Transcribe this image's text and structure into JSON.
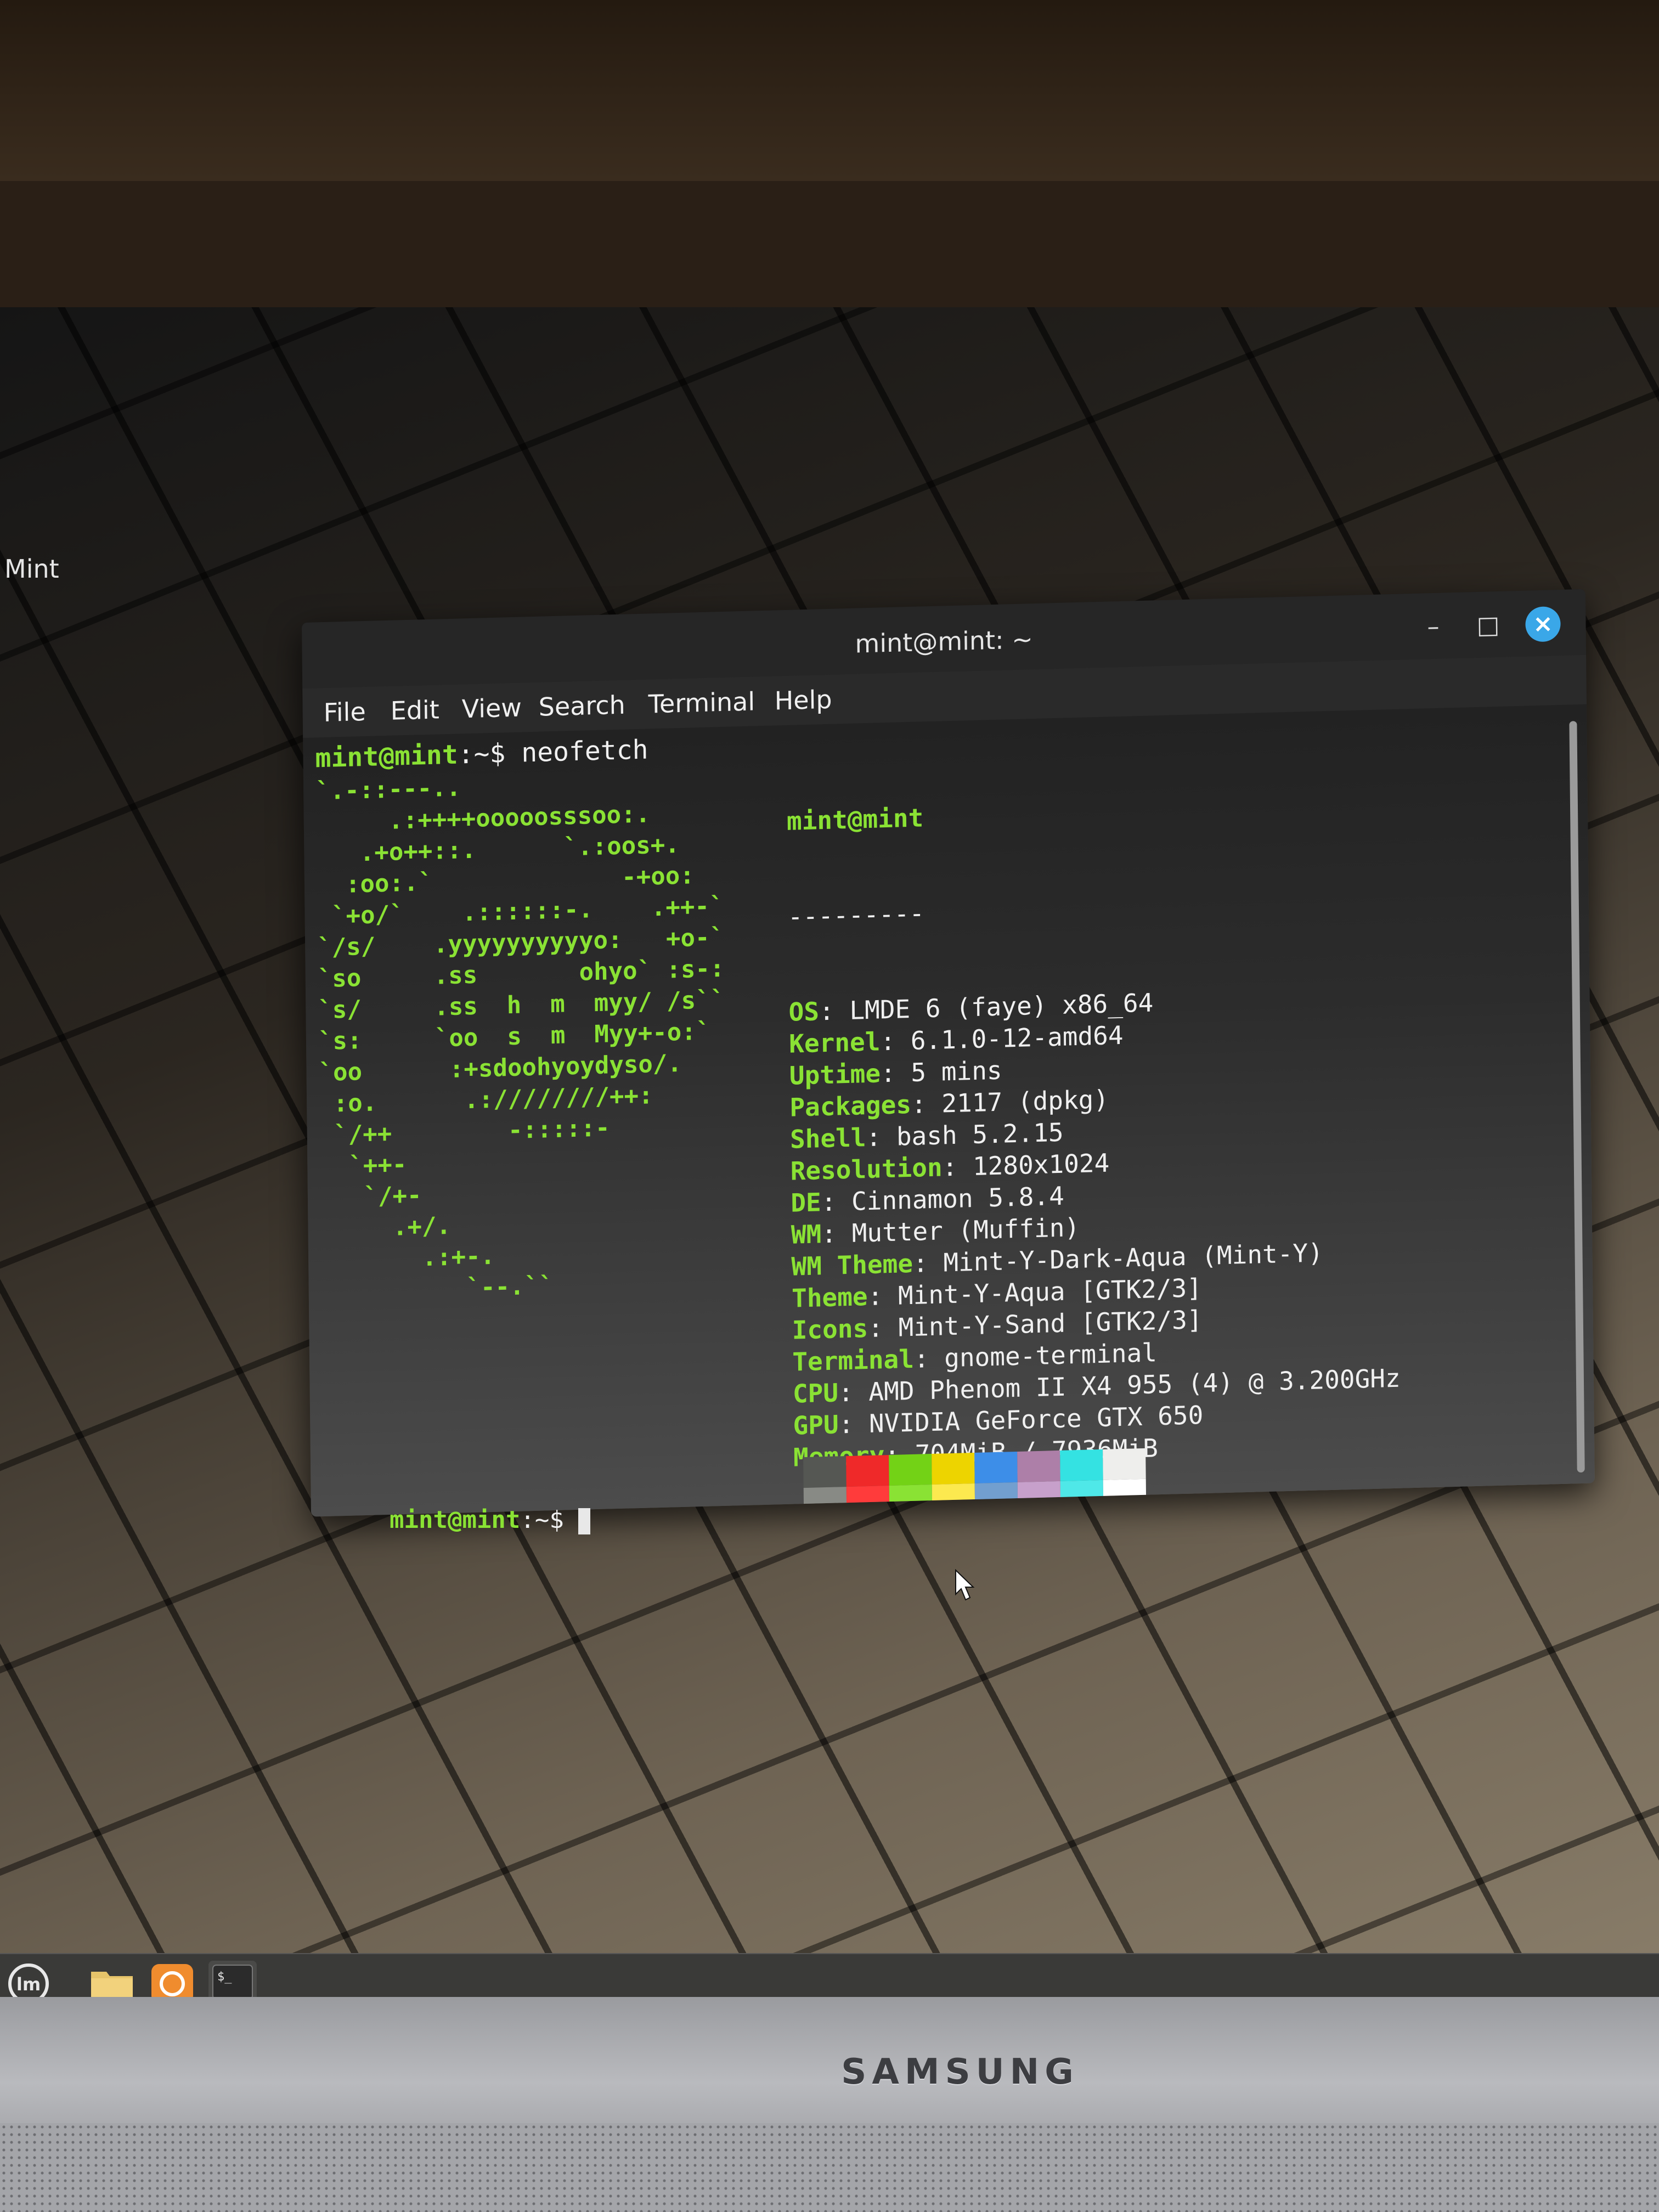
{
  "desktop": {
    "label": "Mint",
    "monitor_brand": "SAMSUNG"
  },
  "terminal": {
    "title": "mint@mint: ~",
    "menu": [
      "File",
      "Edit",
      "View",
      "Search",
      "Terminal",
      "Help"
    ],
    "prompt_user": "mint@mint",
    "prompt_path": ":~$",
    "command": "neofetch",
    "ascii_art": [
      "`.-::---..",
      "     .:++++ooooosssoo:.",
      "   .+o++::.      `.:oos+.",
      "  :oo:.`             -+oo:",
      " `+o/`    .::::::-.    .++-`",
      "`/s/    .yyyyyyyyyyo:   +o-`",
      "`so     .ss       ohyo` :s-:",
      "`s/     .ss  h  m  myy/ /s``",
      "`s:     `oo  s  m  Myy+-o:`",
      "`oo      :+sdoohyoydyso/.",
      " :o.      .:////////++:",
      " `/++        -:::::-",
      "  `++-",
      "   `/+-",
      "     .+/.",
      "       .:+-.",
      "          `--.``"
    ],
    "header": "mint@mint",
    "separator": "---------",
    "info": [
      {
        "key": "OS",
        "value": "LMDE 6 (faye) x86_64"
      },
      {
        "key": "Kernel",
        "value": "6.1.0-12-amd64"
      },
      {
        "key": "Uptime",
        "value": "5 mins"
      },
      {
        "key": "Packages",
        "value": "2117 (dpkg)"
      },
      {
        "key": "Shell",
        "value": "bash 5.2.15"
      },
      {
        "key": "Resolution",
        "value": "1280x1024"
      },
      {
        "key": "DE",
        "value": "Cinnamon 5.8.4"
      },
      {
        "key": "WM",
        "value": "Mutter (Muffin)"
      },
      {
        "key": "WM Theme",
        "value": "Mint-Y-Dark-Aqua (Mint-Y)"
      },
      {
        "key": "Theme",
        "value": "Mint-Y-Aqua [GTK2/3]"
      },
      {
        "key": "Icons",
        "value": "Mint-Y-Sand [GTK2/3]"
      },
      {
        "key": "Terminal",
        "value": "gnome-terminal"
      },
      {
        "key": "CPU",
        "value": "AMD Phenom II X4 955 (4) @ 3.200GHz"
      },
      {
        "key": "GPU",
        "value": "NVIDIA GeForce GTX 650"
      },
      {
        "key": "Memory",
        "value": "704MiB / 7936MiB"
      }
    ],
    "palette_top": [
      "#555753",
      "#ef2929",
      "#73d216",
      "#edd400",
      "#3d8ee8",
      "#ad7fa8",
      "#34e2e2",
      "#eeeeec"
    ],
    "palette_bottom": [
      "#888a85",
      "#ff3b3b",
      "#8ae234",
      "#fce94f",
      "#729fcf",
      "#c7a0cb",
      "#4fe8e8",
      "#ffffff"
    ]
  },
  "icons": {
    "close": "close-icon",
    "minimize": "minimize-icon",
    "maximize": "maximize-icon",
    "menu": "mint-menu-icon",
    "files": "folder-icon",
    "update": "update-manager-icon",
    "terminal": "terminal-icon"
  },
  "colors": {
    "accent": "#3aa7e8",
    "prompt_green": "#8ae234"
  }
}
